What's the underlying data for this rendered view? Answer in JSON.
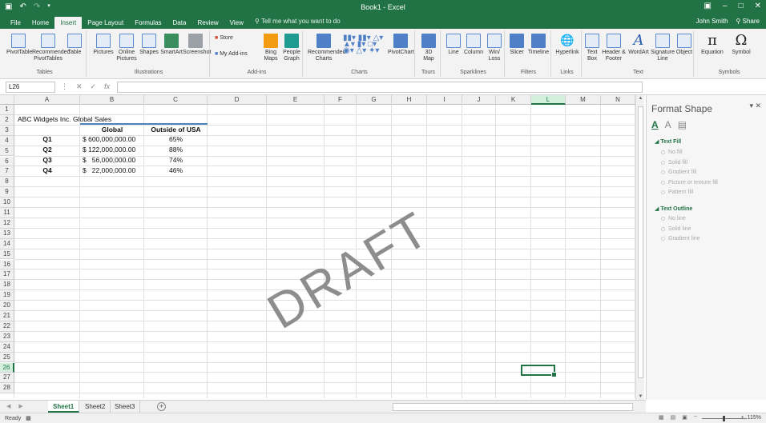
{
  "window": {
    "title": "Book1 - Excel",
    "user": "John Smith",
    "share": "Share"
  },
  "tabs": [
    "File",
    "Home",
    "Insert",
    "Page Layout",
    "Formulas",
    "Data",
    "Review",
    "View"
  ],
  "tell_me": "Tell me what you want to do",
  "ribbon": {
    "tables": {
      "label": "Tables",
      "buttons": [
        "PivotTable",
        "Recommended PivotTables",
        "Table"
      ]
    },
    "illustrations": {
      "label": "Illustrations",
      "buttons": [
        "Pictures",
        "Online Pictures",
        "Shapes",
        "SmartArt",
        "Screenshot"
      ]
    },
    "addins": {
      "label": "Add-ins",
      "buttons": [
        "Store",
        "My Add-ins",
        "Bing Maps",
        "People Graph"
      ]
    },
    "charts": {
      "label": "Charts",
      "buttons": [
        "Recommended Charts",
        "PivotChart"
      ]
    },
    "tours": {
      "label": "Tours",
      "buttons": [
        "3D Map"
      ]
    },
    "sparklines": {
      "label": "Sparklines",
      "buttons": [
        "Line",
        "Column",
        "Win/ Loss"
      ]
    },
    "filters": {
      "label": "Filters",
      "buttons": [
        "Slicer",
        "Timeline"
      ]
    },
    "links": {
      "label": "Links",
      "buttons": [
        "Hyperlink"
      ]
    },
    "text": {
      "label": "Text",
      "buttons": [
        "Text Box",
        "Header & Footer",
        "WordArt",
        "Signature Line",
        "Object"
      ]
    },
    "symbols": {
      "label": "Symbols",
      "buttons": [
        "Equation",
        "Symbol"
      ]
    }
  },
  "formula_bar": {
    "name_box": "L26",
    "fx": "fx",
    "value": ""
  },
  "columns": [
    "A",
    "B",
    "C",
    "D",
    "E",
    "F",
    "G",
    "H",
    "I",
    "J",
    "K",
    "L",
    "M",
    "N"
  ],
  "selected_column": "L",
  "rows": [
    "1",
    "2",
    "3",
    "4",
    "5",
    "6",
    "7",
    "8",
    "9",
    "10",
    "11",
    "12",
    "13",
    "14",
    "15",
    "16",
    "17",
    "18",
    "19",
    "20",
    "21",
    "22",
    "23",
    "24",
    "25",
    "26",
    "27",
    "28"
  ],
  "selected_row": "26",
  "cells": {
    "title": "ABC Widgets Inc. Global Sales",
    "header_global": "Global",
    "header_outside": "Outside of USA",
    "rows": [
      {
        "q": "Q1",
        "global": "$ 600,000,000.00",
        "outside": "65%"
      },
      {
        "q": "Q2",
        "global": "$ 122,000,000.00",
        "outside": "88%"
      },
      {
        "q": "Q3",
        "global": "$   56,000,000.00",
        "outside": "74%"
      },
      {
        "q": "Q4",
        "global": "$   22,000,000.00",
        "outside": "46%"
      }
    ]
  },
  "watermark": "DRAFT",
  "format_pane": {
    "title": "Format Shape",
    "text_fill": {
      "heading": "Text Fill",
      "options": [
        "No fill",
        "Solid fill",
        "Gradient fill",
        "Picture or texture fill",
        "Pattern fill"
      ]
    },
    "text_outline": {
      "heading": "Text Outline",
      "options": [
        "No line",
        "Solid line",
        "Gradient line"
      ]
    }
  },
  "sheets": [
    "Sheet1",
    "Sheet2",
    "Sheet3"
  ],
  "active_sheet": "Sheet1",
  "status": {
    "ready": "Ready",
    "zoom": "115%"
  },
  "colors": {
    "accent": "#217346",
    "header_line": "#4f81bd"
  }
}
